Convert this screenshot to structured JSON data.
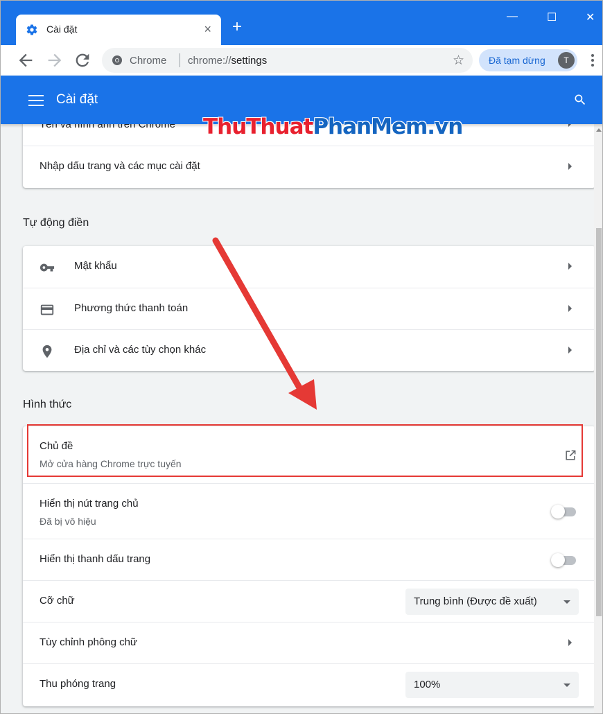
{
  "browser": {
    "tab_title": "Cài đặt",
    "tab_close": "×",
    "new_tab": "+",
    "window_controls": {
      "minimize": "—",
      "maximize": "☐",
      "close": "✕"
    },
    "omnibox": {
      "site_label": "Chrome",
      "url_scheme": "chrome://",
      "url_path": "settings"
    },
    "profile": {
      "status": "Đã tạm dừng",
      "avatar_letter": "T"
    }
  },
  "header": {
    "title": "Cài đặt"
  },
  "watermark": {
    "part1": "ThuThuat",
    "part2": "PhanMem.vn"
  },
  "sections": {
    "top_card": {
      "items": [
        {
          "label": "Tên và hình ảnh trên Chrome"
        },
        {
          "label": "Nhập dấu trang và các mục cài đặt"
        }
      ]
    },
    "autofill": {
      "title": "Tự động điền",
      "items": [
        {
          "label": "Mật khẩu",
          "icon": "key-icon"
        },
        {
          "label": "Phương thức thanh toán",
          "icon": "credit-card-icon"
        },
        {
          "label": "Địa chỉ và các tùy chọn khác",
          "icon": "location-pin-icon"
        }
      ]
    },
    "appearance": {
      "title": "Hình thức",
      "theme": {
        "label": "Chủ đề",
        "sub": "Mở cửa hàng Chrome trực tuyến"
      },
      "home_button": {
        "label": "Hiển thị nút trang chủ",
        "sub": "Đã bị vô hiệu",
        "enabled": false
      },
      "bookmarks_bar": {
        "label": "Hiển thị thanh dấu trang",
        "enabled": false
      },
      "font_size": {
        "label": "Cỡ chữ",
        "value": "Trung bình (Được đề xuất)"
      },
      "customize_fonts": {
        "label": "Tùy chỉnh phông chữ"
      },
      "page_zoom": {
        "label": "Thu phóng trang",
        "value": "100%"
      }
    }
  },
  "colors": {
    "accent": "#1a73e8",
    "annotation_red": "#e53935"
  }
}
